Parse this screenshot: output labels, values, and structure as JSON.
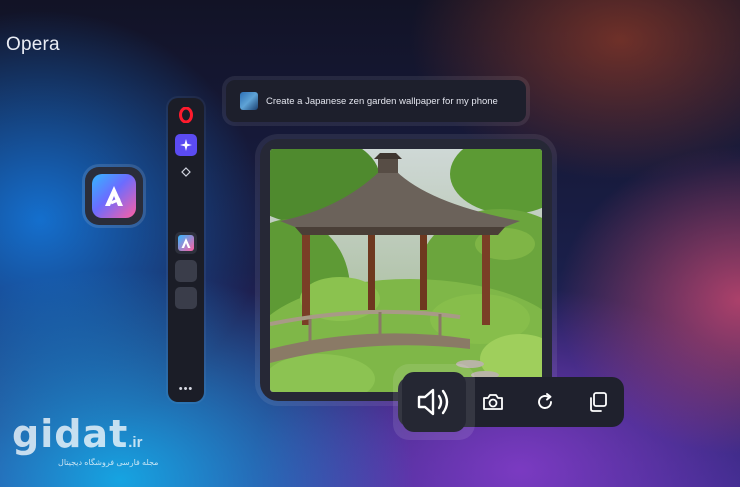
{
  "brand": {
    "name": "Opera"
  },
  "prompt": {
    "text": "Create a Japanese zen garden  wallpaper for my phone"
  },
  "sidebar": {
    "items": [
      {
        "icon": "opera-logo-icon"
      },
      {
        "icon": "ai-sparkle-icon",
        "active": true
      },
      {
        "icon": "diamond-icon"
      },
      {
        "icon": "aria-app-icon"
      },
      {
        "icon": "empty-slot"
      },
      {
        "icon": "empty-slot"
      },
      {
        "icon": "more-icon",
        "label": "•••"
      }
    ]
  },
  "image_card": {
    "subject": "japanese-pavilion-zen-garden"
  },
  "toolbar": {
    "buttons": [
      {
        "icon": "speaker-icon"
      },
      {
        "icon": "camera-icon"
      },
      {
        "icon": "refresh-icon"
      },
      {
        "icon": "copy-icon"
      }
    ]
  },
  "watermark": {
    "name": "gidat",
    "tld": ".ir",
    "tagline": "مجله فارسی فروشگاه دیجیتال"
  },
  "colors": {
    "accent": "#5b4bf2",
    "opera_red": "#ff1b2d"
  }
}
